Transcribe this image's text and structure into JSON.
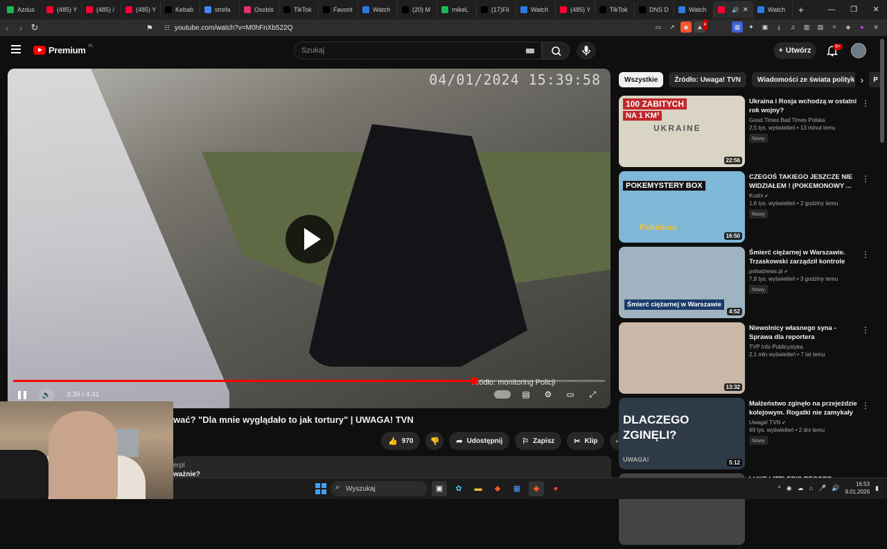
{
  "browser": {
    "tabs": [
      {
        "label": "Azdus",
        "color": "#1db954"
      },
      {
        "label": "(485) Y",
        "color": "#ff0033"
      },
      {
        "label": "(485) /",
        "color": "#ff0033"
      },
      {
        "label": "(485) Y",
        "color": "#ff0033"
      },
      {
        "label": "Kebab",
        "color": "#000000"
      },
      {
        "label": "strefa",
        "color": "#4285f4"
      },
      {
        "label": "Osobis",
        "color": "#e1306c"
      },
      {
        "label": "TikTok",
        "color": "#000000"
      },
      {
        "label": "Favorit",
        "color": "#000000"
      },
      {
        "label": "Watch",
        "color": "#2b7be4"
      },
      {
        "label": "(20) M",
        "color": "#000000"
      },
      {
        "label": "mikeL",
        "color": "#1db954"
      },
      {
        "label": "(17)Fil",
        "color": "#000000"
      },
      {
        "label": "Watch",
        "color": "#2b7be4"
      },
      {
        "label": "(485) Y",
        "color": "#ff0033"
      },
      {
        "label": "TikTok",
        "color": "#000000"
      },
      {
        "label": "DNS D",
        "color": "#000000"
      },
      {
        "label": "Watch",
        "color": "#2b7be4"
      },
      {
        "label": "",
        "color": "#ff0033"
      },
      {
        "label": "Watch",
        "color": "#2b7be4"
      }
    ],
    "new_tab": "+",
    "url": "youtube.com/watch?v=M0hFnXb522Q",
    "notif_count": "4"
  },
  "youtube": {
    "logo_text": "Premium",
    "logo_region": "PL",
    "search_placeholder": "Szukaj",
    "create_label": "Utwórz",
    "notifications_badge": "9+"
  },
  "player": {
    "osd_timestamp": "04/01/2024 15:39:58",
    "source_caption": "Źródło: monitoring Policji",
    "time_display": "3:39 / 4:41",
    "progress_fraction": 0.779
  },
  "video": {
    "title_visible": "wać? \"Dla mnie wyglądało to jak tortury\" | UWAGA! TVN",
    "likes": "970",
    "share_label": "Udostępnij",
    "save_label": "Zapisz",
    "clip_label": "Klip",
    "desc_line1": "erpl",
    "desc_line2": "ważnie?"
  },
  "chips": [
    "Wszystkie",
    "Źródło: Uwaga! TVN",
    "Wiadomości ze świata polityki",
    "P"
  ],
  "recommendations": [
    {
      "title": "Ukraina i Rosja wchodzą w ostatni rok wojny?",
      "channel": "Good Times Bad Times Polska",
      "meta": "2,5 tys. wyświetleń • 13 minut temu",
      "badge": "Nowy",
      "duration": "22:56",
      "thumb_text": "100 ZABITYCH",
      "thumb_text2": "NA 1 KM²",
      "thumb_text3": "UKRAINE",
      "verified": false,
      "thumb_color": "#d9d4c4"
    },
    {
      "title": "CZEGOŚ TAKIEGO JESZCZE NIE WIDZIAŁEM ! (POKEMONOWY ...",
      "channel": "Kushi",
      "meta": "1,6 tys. wyświetleń • 2 godziny temu",
      "badge": "Nowy",
      "duration": "16:50",
      "thumb_text": "POKEMYSTERY BOX",
      "thumb_text2": "Pokémon",
      "thumb_text3": "",
      "verified": true,
      "thumb_color": "#7fb7d6"
    },
    {
      "title": "Śmierć ciężarnej w Warszawie. Trzaskowski zarządził kontrole",
      "channel": "polsatnews.pl",
      "meta": "7,8 tys. wyświetleń • 3 godziny temu",
      "badge": "Nowy",
      "duration": "4:52",
      "thumb_text": "Śmierć ciężarnej w Warszawie",
      "thumb_text2": "",
      "thumb_text3": "",
      "verified": true,
      "thumb_color": "#9fb3c0"
    },
    {
      "title": "Niewolnicy własnego syna - Sprawa dla reportera",
      "channel": "TVP Info Publicystyka",
      "meta": "2,1 mln wyświetleń • 7 lat temu",
      "badge": "",
      "duration": "13:32",
      "thumb_text": "",
      "thumb_text2": "",
      "thumb_text3": "",
      "verified": false,
      "thumb_color": "#c9b8a8"
    },
    {
      "title": "Małżeństwo zginęło na przejeździe kolejowym. Rogatki nie zamykały się ...",
      "channel": "Uwaga! TVN",
      "meta": "69 tys. wyświetleń • 2 dni temu",
      "badge": "Nowy",
      "duration": "5:12",
      "thumb_text": "DLACZEGO",
      "thumb_text2": "ZGINĘLI?",
      "thumb_text3": "UWAGA!",
      "verified": true,
      "thumb_color": "#2f3a48"
    },
    {
      "title": "LUKE LITTLER'S RECORD BREAKING",
      "channel": "",
      "meta": "",
      "badge": "",
      "duration": "",
      "thumb_text": "",
      "thumb_text2": "",
      "thumb_text3": "",
      "verified": false,
      "thumb_color": "#444444"
    }
  ],
  "taskbar": {
    "search_label": "Wyszukaj",
    "time": "16:53",
    "date": "9.01.2026"
  }
}
